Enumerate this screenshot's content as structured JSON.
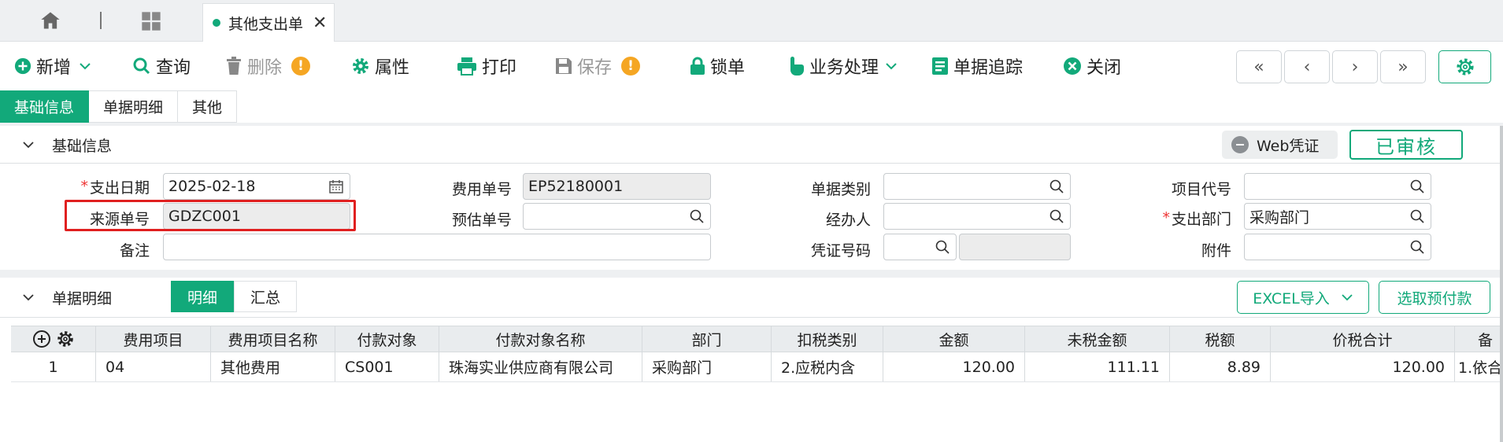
{
  "tabs": {
    "doc_tab_label": "其他支出单",
    "close_glyph": "✕"
  },
  "toolbar": {
    "new": "新增",
    "query": "查询",
    "delete": "删除",
    "props": "属性",
    "print": "打印",
    "save": "保存",
    "lock": "锁单",
    "process": "业务处理",
    "trace": "单据追踪",
    "close": "关闭",
    "warn_glyph": "!",
    "nav": {
      "first": "«",
      "prev": "‹",
      "next": "›",
      "last": "»"
    }
  },
  "section_tabs": [
    "基础信息",
    "单据明细",
    "其他"
  ],
  "basic": {
    "title": "基础信息",
    "web_voucher": "Web凭证",
    "status_stamp": "已审核"
  },
  "form": {
    "required_mark": "*",
    "date_label": "支出日期",
    "date_value": "2025-02-18",
    "expense_no_label": "费用单号",
    "expense_no_value": "EP52180001",
    "doc_type_label": "单据类别",
    "doc_type_value": "",
    "project_label": "项目代号",
    "project_value": "",
    "source_no_label": "来源单号",
    "source_no_value": "GDZC001",
    "estimate_no_label": "预估单号",
    "estimate_no_value": "",
    "handler_label": "经办人",
    "handler_value": "",
    "dept_label": "支出部门",
    "dept_value": "采购部门",
    "remark_label": "备注",
    "remark_value": "",
    "voucher_no_label": "凭证号码",
    "voucher_no_value": "",
    "voucher_no_value2": "",
    "attach_label": "附件",
    "attach_value": ""
  },
  "detail": {
    "title": "单据明细",
    "subtabs": [
      "明细",
      "汇总"
    ],
    "excel_import": "EXCEL导入",
    "select_prepay": "选取预付款"
  },
  "table": {
    "headers": [
      "费用项目",
      "费用项目名称",
      "付款对象",
      "付款对象名称",
      "部门",
      "扣税类别",
      "金额",
      "未税金额",
      "税额",
      "价税合计",
      "备"
    ],
    "rows": [
      [
        "1",
        "04",
        "其他费用",
        "CS001",
        "珠海实业供应商有限公司",
        "采购部门",
        "2.应税内含",
        "120.00",
        "111.11",
        "8.89",
        "120.00",
        "1.依合"
      ]
    ]
  },
  "colors": {
    "accent": "#12a97a",
    "warning": "#f5a623",
    "highlight": "#e02020"
  }
}
